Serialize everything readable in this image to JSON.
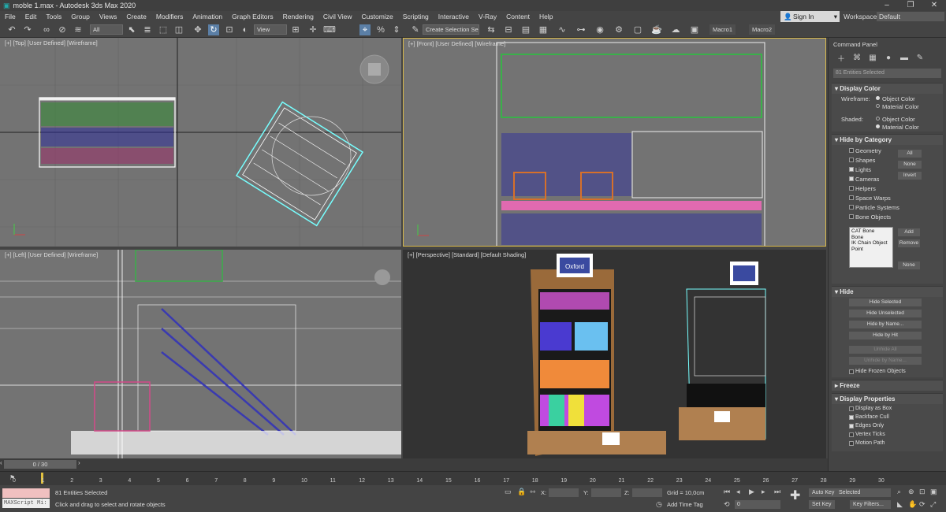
{
  "titlebar": {
    "title": "moble 1.max - Autodesk 3ds Max 2020",
    "min": "–",
    "max": "❐",
    "close": "✕"
  },
  "menu": [
    "File",
    "Edit",
    "Tools",
    "Group",
    "Views",
    "Create",
    "Modifiers",
    "Animation",
    "Graph Editors",
    "Rendering",
    "Civil View",
    "Customize",
    "Scripting",
    "Interactive",
    "V-Ray",
    "Content",
    "Help"
  ],
  "signin": "Sign In",
  "workspaces": {
    "label": "Workspaces:",
    "value": "Default"
  },
  "toolbar": {
    "filter": "All",
    "refcoord": "View",
    "selset": "Create Selection Se",
    "macro1": "Macro1",
    "macro2": "Macro2"
  },
  "viewports": {
    "top": "[+] [Top] [User Defined] [Wireframe]",
    "front": "[+] [Front] [User Defined] [Wireframe]",
    "left": "[+] [Left] [User Defined] [Wireframe]",
    "persp": "[+] [Perspective] [Standard] [Default Shading]"
  },
  "cmd": {
    "title": "Command Panel",
    "entries": "81 Entities Selected",
    "display_color": {
      "header": "Display Color",
      "wireframe": "Wireframe:",
      "shaded": "Shaded:",
      "obj": "Object Color",
      "mat": "Material Color"
    },
    "hide_by_cat": {
      "header": "Hide by Category",
      "items": [
        "Geometry",
        "Shapes",
        "Lights",
        "Cameras",
        "Helpers",
        "Space Warps",
        "Particle Systems",
        "Bone Objects"
      ],
      "all": "All",
      "none": "None",
      "invert": "Invert",
      "list": [
        "CAT Bone",
        "Bone",
        "IK Chain Object",
        "Point"
      ],
      "add": "Add",
      "remove": "Remove",
      "none2": "None"
    },
    "hide": {
      "header": "Hide",
      "buttons": [
        "Hide Selected",
        "Hide Unselected",
        "Hide by Name...",
        "Hide by Hit",
        "Unhide All",
        "Unhide by Name..."
      ],
      "frozen": "Hide Frozen Objects"
    },
    "freeze": {
      "header": "Freeze"
    },
    "display_props": {
      "header": "Display Properties",
      "items": [
        "Display as Box",
        "Backface Cull",
        "Edges Only",
        "Vertex Ticks",
        "Motion Path"
      ]
    }
  },
  "time": {
    "slider": "0 / 30",
    "ticks": [
      "0",
      "1",
      "2",
      "3",
      "4",
      "5",
      "6",
      "7",
      "8",
      "9",
      "10",
      "11",
      "12",
      "13",
      "14",
      "15",
      "16",
      "17",
      "18",
      "19",
      "20",
      "21",
      "22",
      "23",
      "24",
      "25",
      "26",
      "27",
      "28",
      "29",
      "30"
    ]
  },
  "status": {
    "maxscript": "MAXScript Mi:",
    "selected": "81 Entities Selected",
    "prompt": "Click and drag to select and rotate objects",
    "x": "X:",
    "y": "Y:",
    "z": "Z:",
    "grid": "Grid = 10,0cm",
    "addtime": "Add Time Tag",
    "autokey": "Auto Key",
    "setkey": "Set Key",
    "selected_dd": "Selected",
    "keyfilters": "Key Filters...",
    "frame": "0"
  },
  "persp_labels": {
    "brand": "Oxford"
  }
}
